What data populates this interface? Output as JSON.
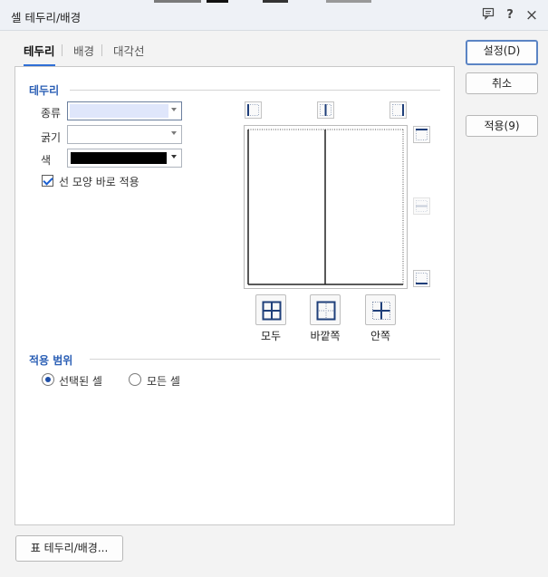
{
  "window": {
    "title": "셀 테두리/배경",
    "help_label": "?",
    "close_label": "×"
  },
  "tabs": [
    {
      "label": "테두리",
      "active": true
    },
    {
      "label": "배경",
      "active": false
    },
    {
      "label": "대각선",
      "active": false
    }
  ],
  "border_section": {
    "title": "테두리",
    "kind_label": "종류",
    "thickness_label": "굵기",
    "color_label": "색",
    "color_value": "#000000",
    "apply_immediately_label": "선 모양 바로 적용",
    "apply_immediately_checked": true,
    "presets": [
      {
        "label": "모두"
      },
      {
        "label": "바깥쪽"
      },
      {
        "label": "안쪽"
      }
    ]
  },
  "scope_section": {
    "title": "적용 범위",
    "options": [
      {
        "label": "선택된 셀",
        "selected": true
      },
      {
        "label": "모든 셀",
        "selected": false
      }
    ]
  },
  "buttons": {
    "ok": "설정(D)",
    "cancel": "취소",
    "apply": "적용(9)",
    "table_border": "표 테두리/배경..."
  }
}
